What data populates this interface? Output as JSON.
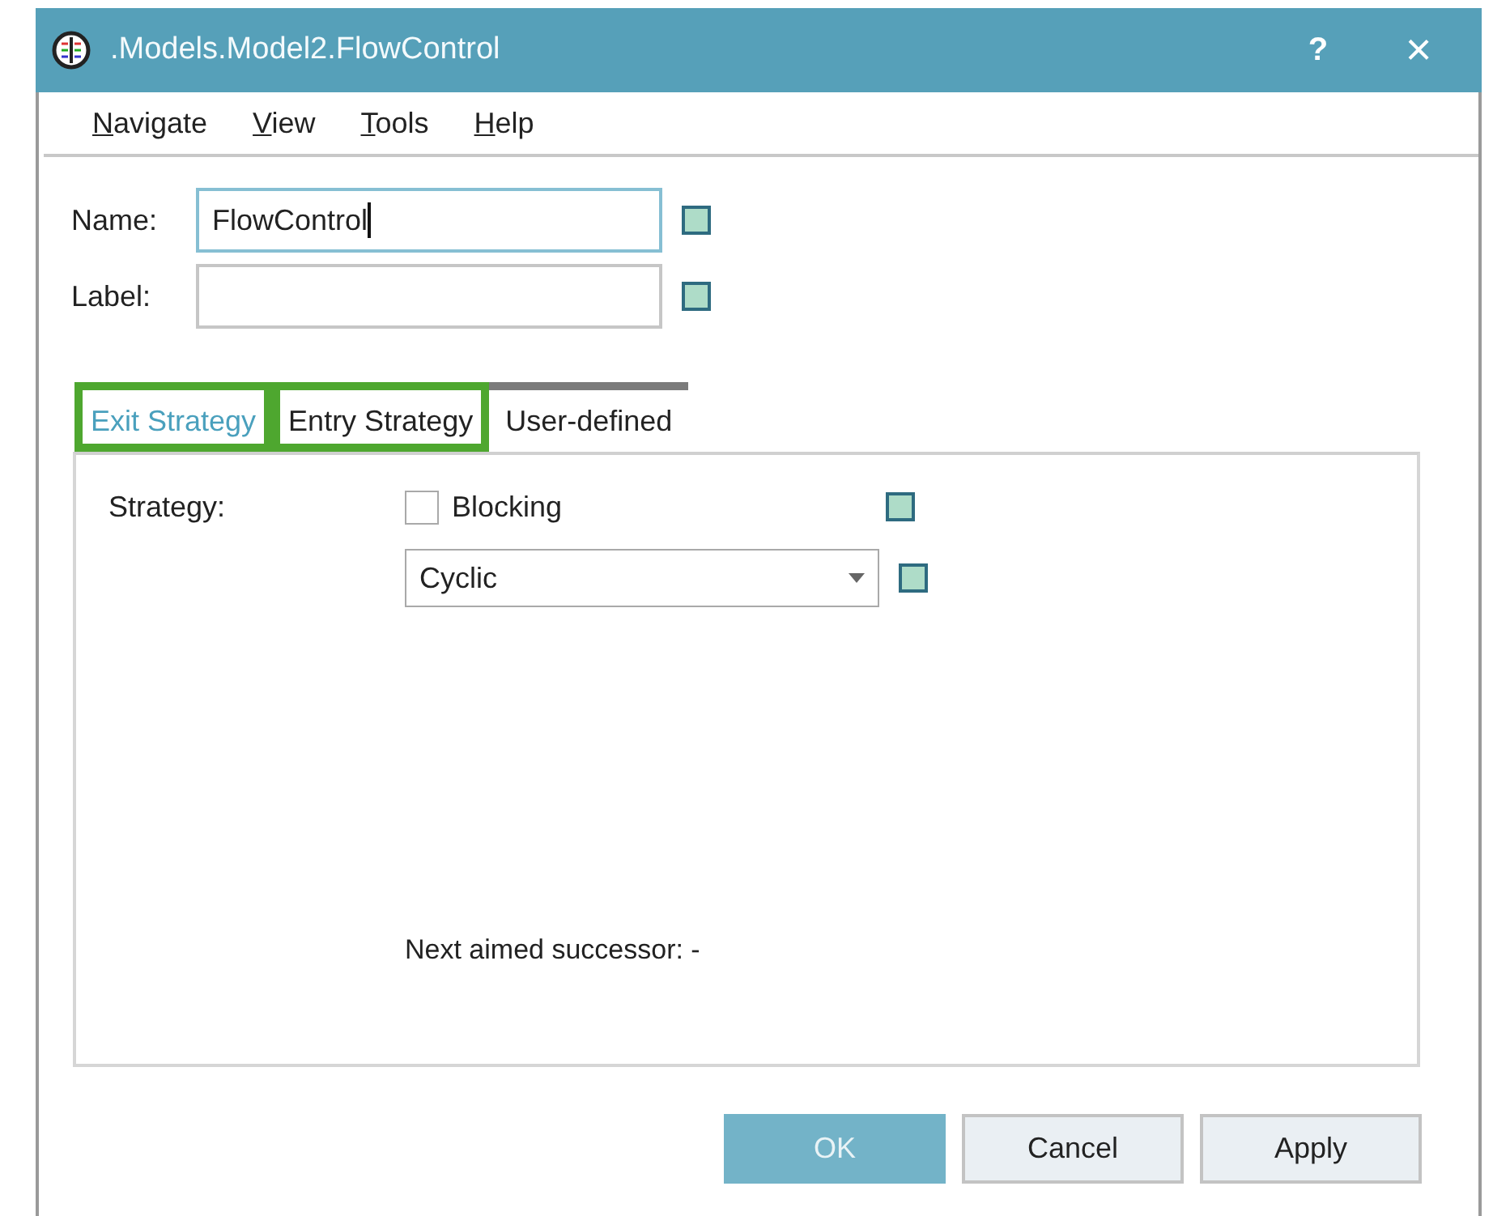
{
  "window": {
    "title": ".Models.Model2.FlowControl",
    "help_button": "?",
    "close_button": "×"
  },
  "menu": [
    {
      "label": "Navigate"
    },
    {
      "label": "View"
    },
    {
      "label": "Tools"
    },
    {
      "label": "Help"
    }
  ],
  "fields": [
    {
      "label": "Name:",
      "value": "FlowControl",
      "focused": true
    },
    {
      "label": "Label:",
      "focused": false
    }
  ],
  "tabs": [
    {
      "label": "Exit Strategy",
      "selected": true,
      "highlighted": true,
      "hovered": false
    },
    {
      "label": "Entry Strategy",
      "selected": false,
      "highlighted": true,
      "hovered": false
    },
    {
      "label": "User-defined",
      "selected": false,
      "highlighted": false,
      "hovered": true
    }
  ],
  "panel": {
    "strategy_label": "Strategy:",
    "blocking": {
      "label": "Blocking",
      "checked": false
    },
    "strategy_select": {
      "value": "Cyclic"
    },
    "next_successor": "Next aimed successor: -"
  },
  "buttons": [
    {
      "label": "OK",
      "kind": "default"
    },
    {
      "label": "Cancel",
      "kind": "normal"
    },
    {
      "label": "Apply",
      "kind": "normal"
    }
  ]
}
